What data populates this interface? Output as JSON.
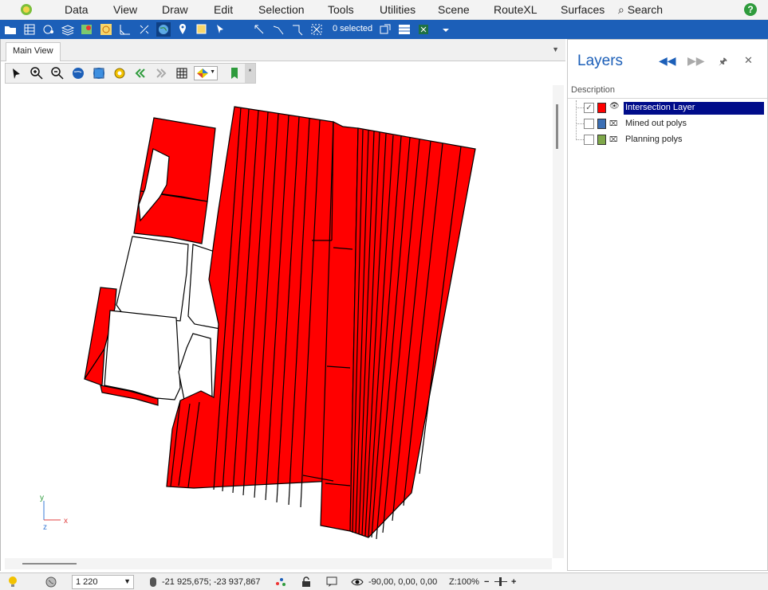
{
  "menu": {
    "items": [
      "Data",
      "View",
      "Draw",
      "Edit",
      "Selection",
      "Tools",
      "Utilities",
      "Scene",
      "RouteXL",
      "Surfaces"
    ],
    "search_label": "Search"
  },
  "toolbar": {
    "selected_label": "0 selected"
  },
  "doc": {
    "tab_label": "Main View"
  },
  "axes": {
    "y_label": "y",
    "z_label": "z",
    "x_label": "x"
  },
  "layers": {
    "title": "Layers",
    "column_header": "Description",
    "items": [
      {
        "label": "Intersection Layer",
        "checked": true,
        "color": "#ff0000",
        "selected": true
      },
      {
        "label": "Mined out polys",
        "checked": false,
        "color": "#3b6fb5",
        "selected": false
      },
      {
        "label": "Planning polys",
        "checked": false,
        "color": "#7fa84a",
        "selected": false
      }
    ]
  },
  "status": {
    "scale": "1 220",
    "coordinates": "-21 925,675; -23 937,867",
    "rotation": "-90,00, 0,00, 0,00",
    "zoom": "Z:100%"
  },
  "colors": {
    "accent": "#1c5fb8",
    "polygon_fill": "#ff0000",
    "selection": "#000c8a"
  }
}
